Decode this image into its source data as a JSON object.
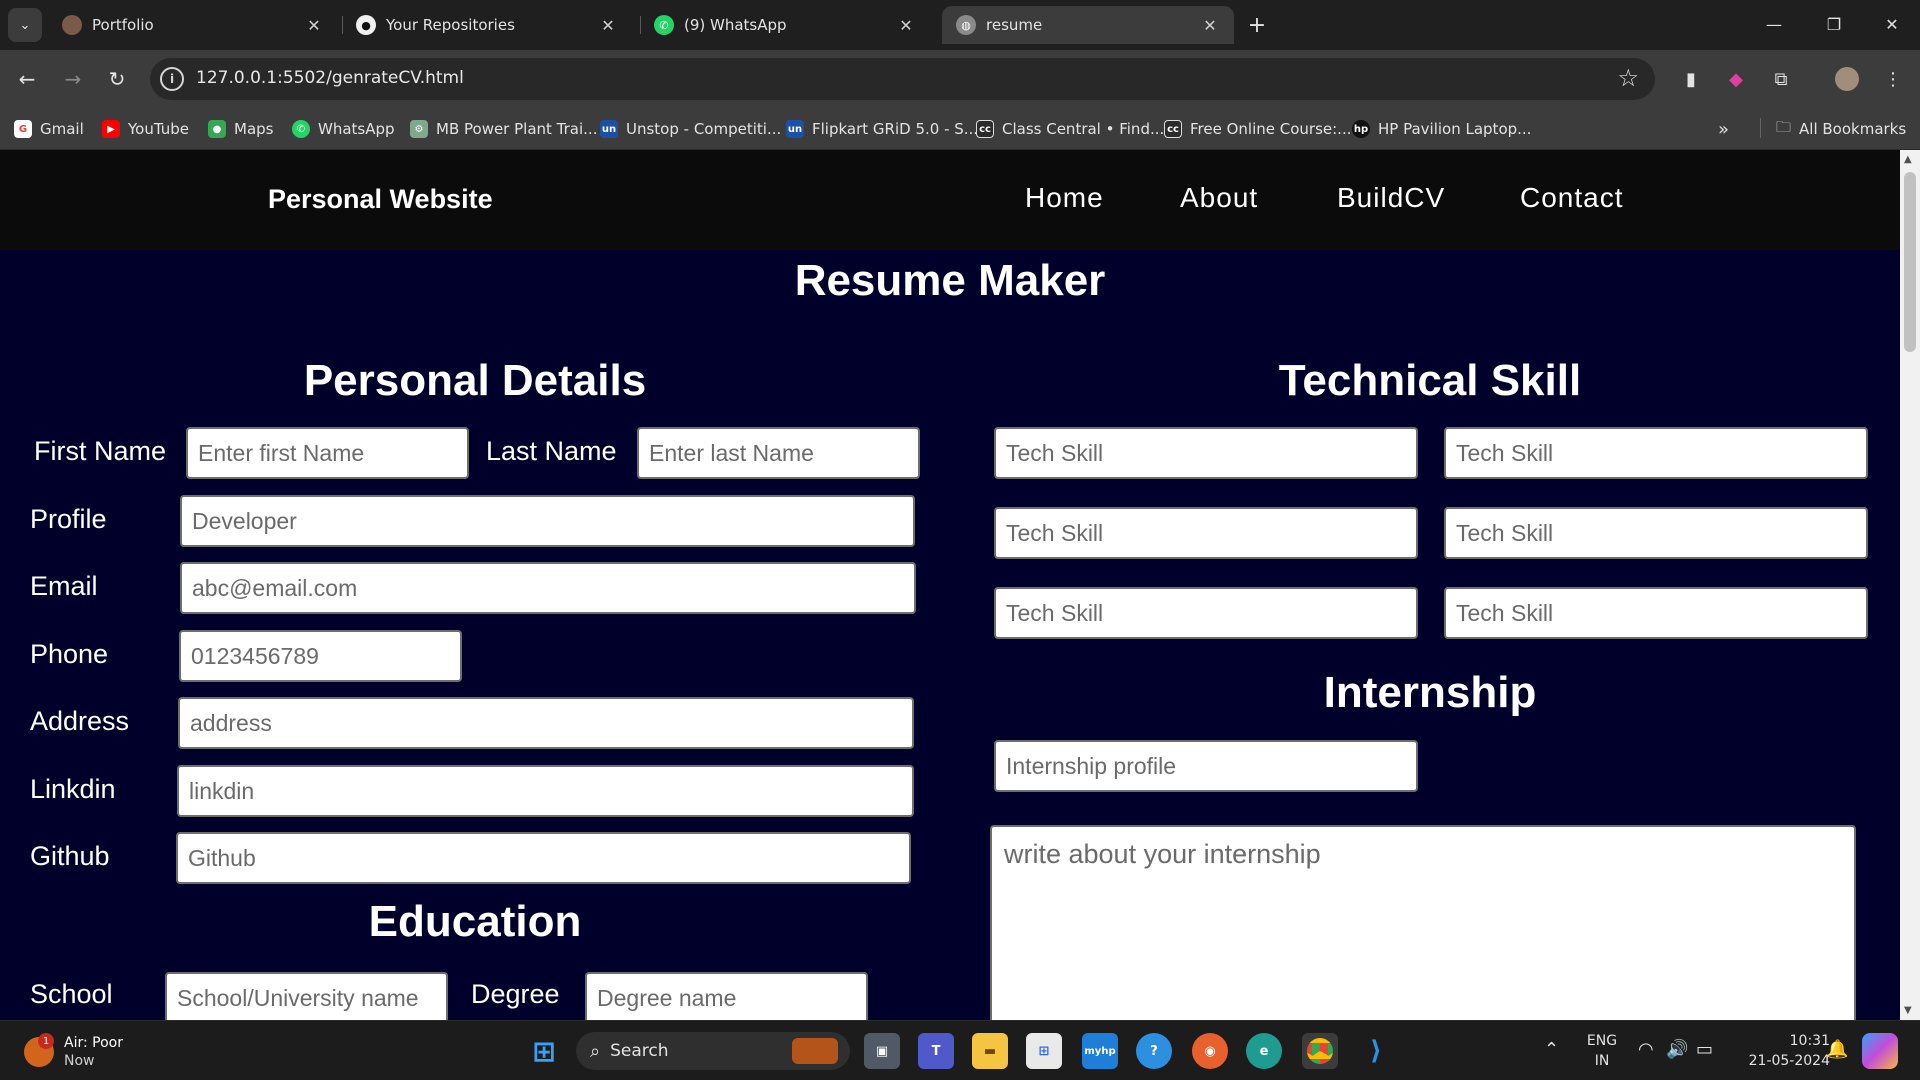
{
  "browser": {
    "tabs": [
      {
        "title": "Portfolio",
        "active": false
      },
      {
        "title": "Your Repositories",
        "active": false
      },
      {
        "title": "(9) WhatsApp",
        "active": false
      },
      {
        "title": "resume",
        "active": true
      }
    ],
    "url": "127.0.0.1:5502/genrateCV.html",
    "bookmarks": [
      "Gmail",
      "YouTube",
      "Maps",
      "WhatsApp",
      "MB Power Plant Trai...",
      "Unstop - Competiti...",
      "Flipkart GRiD 5.0 - S...",
      "Class Central • Find...",
      "Free Online Course:...",
      "HP Pavilion Laptop..."
    ],
    "all_bookmarks": "All Bookmarks"
  },
  "site": {
    "brand": "Personal Website",
    "nav": [
      "Home",
      "About",
      "BuildCV",
      "Contact"
    ],
    "page_title": "Resume Maker"
  },
  "personal": {
    "title": "Personal Details",
    "first_name_label": "First Name",
    "first_name_placeholder": "Enter first Name",
    "last_name_label": "Last Name",
    "last_name_placeholder": "Enter last Name",
    "profile_label": "Profile",
    "profile_placeholder": "Developer",
    "email_label": "Email",
    "email_placeholder": "abc@email.com",
    "phone_label": "Phone",
    "phone_placeholder": "0123456789",
    "address_label": "Address",
    "address_placeholder": "address",
    "linkedin_label": "Linkdin",
    "linkedin_placeholder": "linkdin",
    "github_label": "Github",
    "github_placeholder": "Github"
  },
  "education": {
    "title": "Education",
    "school_label": "School",
    "school_placeholder": "School/University name",
    "degree_label": "Degree",
    "degree_placeholder": "Degree name"
  },
  "technical": {
    "title": "Technical Skill",
    "skill_placeholder": "Tech Skill"
  },
  "internship": {
    "title": "Internship",
    "profile_placeholder": "Internship profile",
    "description_placeholder": "write about your internship"
  },
  "taskbar": {
    "weather_title": "Air: Poor",
    "weather_sub": "Now",
    "weather_badge": "1",
    "search_label": "Search",
    "lang_top": "ENG",
    "lang_bottom": "IN",
    "time": "10:31",
    "date": "21-05-2024"
  }
}
